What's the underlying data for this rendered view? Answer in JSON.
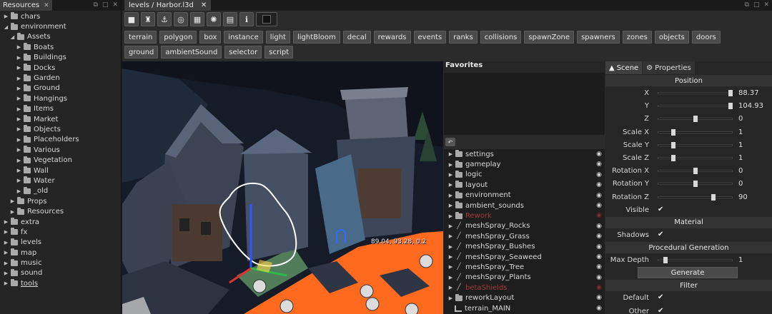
{
  "resources": {
    "tab_label": "Resources",
    "tree": [
      {
        "label": "chars",
        "depth": 0,
        "open": false
      },
      {
        "label": "environment",
        "depth": 0,
        "open": true
      },
      {
        "label": "Assets",
        "depth": 1,
        "open": true
      },
      {
        "label": "Boats",
        "depth": 2,
        "open": false
      },
      {
        "label": "Buildings",
        "depth": 2,
        "open": false
      },
      {
        "label": "Docks",
        "depth": 2,
        "open": false
      },
      {
        "label": "Garden",
        "depth": 2,
        "open": false
      },
      {
        "label": "Ground",
        "depth": 2,
        "open": false
      },
      {
        "label": "Hangings",
        "depth": 2,
        "open": false
      },
      {
        "label": "Items",
        "depth": 2,
        "open": false
      },
      {
        "label": "Market",
        "depth": 2,
        "open": false
      },
      {
        "label": "Objects",
        "depth": 2,
        "open": false
      },
      {
        "label": "Placeholders",
        "depth": 2,
        "open": false
      },
      {
        "label": "Various",
        "depth": 2,
        "open": false
      },
      {
        "label": "Vegetation",
        "depth": 2,
        "open": false
      },
      {
        "label": "Wall",
        "depth": 2,
        "open": false
      },
      {
        "label": "Water",
        "depth": 2,
        "open": false
      },
      {
        "label": "_old",
        "depth": 2,
        "open": false
      },
      {
        "label": "Props",
        "depth": 1,
        "open": false
      },
      {
        "label": "Resources",
        "depth": 1,
        "open": false
      },
      {
        "label": "extra",
        "depth": 0,
        "open": false
      },
      {
        "label": "fx",
        "depth": 0,
        "open": false
      },
      {
        "label": "levels",
        "depth": 0,
        "open": false
      },
      {
        "label": "map",
        "depth": 0,
        "open": false
      },
      {
        "label": "music",
        "depth": 0,
        "open": false
      },
      {
        "label": "sound",
        "depth": 0,
        "open": false
      },
      {
        "label": "tools",
        "depth": 0,
        "open": false,
        "underline": true
      }
    ]
  },
  "editor": {
    "tab_label": "levels / Harbor.l3d",
    "toolbar_icons": [
      "camera-icon",
      "trophy-icon",
      "anchor-icon",
      "target-icon",
      "grid-icon",
      "sun-icon",
      "map-icon",
      "info-icon",
      "color-swatch-icon"
    ],
    "toolbar_glyphs": [
      "■",
      "♜",
      "⚓",
      "◎",
      "▦",
      "✺",
      "▤",
      "ℹ"
    ],
    "categories": [
      "terrain",
      "polygon",
      "box",
      "instance",
      "light",
      "lightBloom",
      "decal",
      "rewards",
      "events",
      "ranks",
      "collisions",
      "spawnZone",
      "spawners",
      "zones",
      "objects",
      "doors",
      "ground",
      "ambientSound",
      "selector",
      "script"
    ],
    "viewport_coord": "89.04, 93.28, 0.2"
  },
  "favorites": {
    "title": "Favorites"
  },
  "layers": [
    {
      "label": "settings",
      "kind": "folder",
      "visible": true
    },
    {
      "label": "gameplay",
      "kind": "folder",
      "visible": true
    },
    {
      "label": "logic",
      "kind": "folder",
      "visible": true
    },
    {
      "label": "layout",
      "kind": "folder",
      "visible": true
    },
    {
      "label": "environment",
      "kind": "folder",
      "visible": true
    },
    {
      "label": "ambient_sounds",
      "kind": "folder",
      "visible": true
    },
    {
      "label": "Rework",
      "kind": "folder",
      "visible": false
    },
    {
      "label": "meshSpray_Rocks",
      "kind": "brush",
      "visible": true
    },
    {
      "label": "meshSpray_Grass",
      "kind": "brush",
      "visible": true
    },
    {
      "label": "meshSpray_Bushes",
      "kind": "brush",
      "visible": true
    },
    {
      "label": "meshSpray_Seaweed",
      "kind": "brush",
      "visible": true
    },
    {
      "label": "meshSpray_Tree",
      "kind": "brush",
      "visible": true
    },
    {
      "label": "meshSpray_Plants",
      "kind": "brush",
      "visible": true
    },
    {
      "label": "betaShields",
      "kind": "brush",
      "visible": false
    },
    {
      "label": "reworkLayout",
      "kind": "folder",
      "visible": true
    },
    {
      "label": "terrain_MAIN",
      "kind": "terrain",
      "visible": true
    }
  ],
  "properties": {
    "tabs": [
      "Scene",
      "Properties"
    ],
    "sections": {
      "position": "Position",
      "material": "Material",
      "procedural": "Procedural Generation",
      "filter": "Filter"
    },
    "position_fields": [
      {
        "label": "X",
        "value": "88.37",
        "fraction": 0.98
      },
      {
        "label": "Y",
        "value": "104.93",
        "fraction": 0.98
      },
      {
        "label": "Z",
        "value": "0",
        "fraction": 0.5
      },
      {
        "label": "Scale X",
        "value": "1",
        "fraction": 0.2
      },
      {
        "label": "Scale Y",
        "value": "1",
        "fraction": 0.2
      },
      {
        "label": "Scale Z",
        "value": "1",
        "fraction": 0.2
      },
      {
        "label": "Rotation X",
        "value": "0",
        "fraction": 0.5
      },
      {
        "label": "Rotation Y",
        "value": "0",
        "fraction": 0.5
      },
      {
        "label": "Rotation Z",
        "value": "90",
        "fraction": 0.75
      }
    ],
    "visible_label": "Visible",
    "shadows_label": "Shadows",
    "max_depth": {
      "label": "Max Depth",
      "value": "1",
      "fraction": 0.1
    },
    "generate_label": "Generate",
    "filters": [
      {
        "label": "Default",
        "checked": true
      },
      {
        "label": "Other",
        "checked": true
      }
    ]
  },
  "colors": {
    "ground_orange": "#ff6a1e",
    "background": "#1e1e1e",
    "panel": "#262626"
  }
}
